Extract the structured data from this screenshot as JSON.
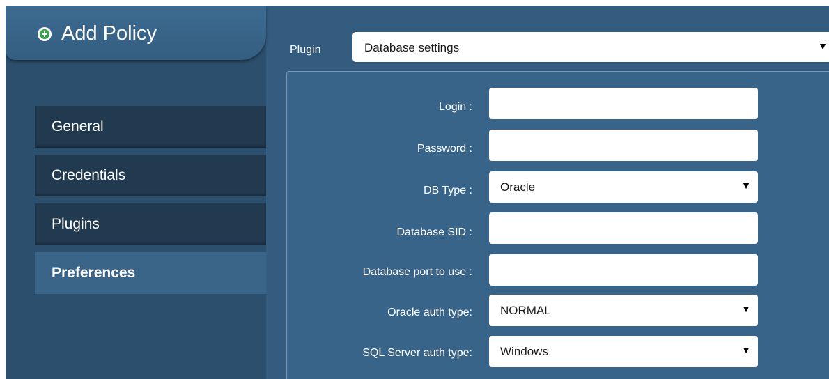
{
  "header": {
    "title": "Add Policy",
    "icon": "add-circle-icon"
  },
  "nav": {
    "items": [
      {
        "label": "General",
        "active": false
      },
      {
        "label": "Credentials",
        "active": false
      },
      {
        "label": "Plugins",
        "active": false
      },
      {
        "label": "Preferences",
        "active": true
      }
    ]
  },
  "plugin": {
    "label": "Plugin",
    "selected": "Database settings"
  },
  "form": {
    "login": {
      "label": "Login :",
      "value": ""
    },
    "password": {
      "label": "Password :",
      "value": ""
    },
    "db_type": {
      "label": "DB Type :",
      "selected": "Oracle"
    },
    "database_sid": {
      "label": "Database SID :",
      "value": ""
    },
    "database_port": {
      "label": "Database port to use :",
      "value": ""
    },
    "oracle_auth": {
      "label": "Oracle auth type:",
      "selected": "NORMAL"
    },
    "sql_server_auth": {
      "label": "SQL Server auth type:",
      "selected": "Windows"
    }
  },
  "colors": {
    "background": "#335c7f",
    "sidebar": "#2c4f6d",
    "nav_item": "#223a50",
    "nav_active": "#3a6488",
    "add_icon": "#3aa64a"
  },
  "icons": {
    "dropdown": "triangle-down-icon"
  }
}
